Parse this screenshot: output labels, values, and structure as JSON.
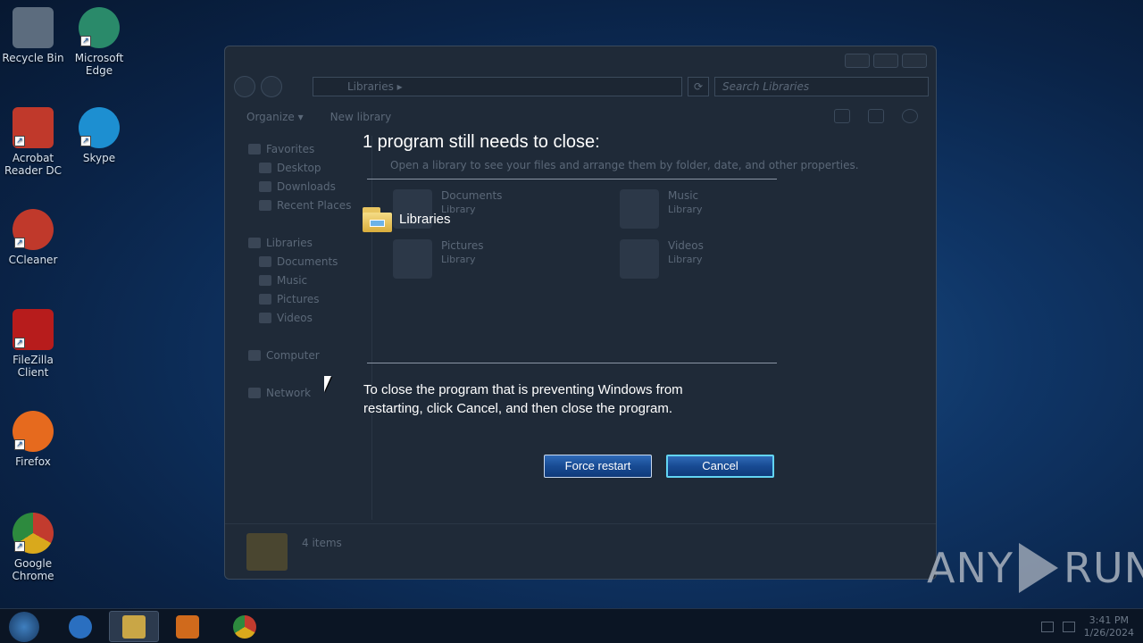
{
  "desktop": {
    "icons": [
      {
        "label": "Recycle Bin",
        "icon": "recycle-bin-icon",
        "color": "#6b7c8f"
      },
      {
        "label": "Microsoft Edge",
        "icon": "edge-icon",
        "color": "#2a8a6a"
      },
      {
        "label": "Acrobat Reader DC",
        "icon": "acrobat-icon",
        "color": "#c0392b"
      },
      {
        "label": "Skype",
        "icon": "skype-icon",
        "color": "#1d8fd1"
      },
      {
        "label": "CCleaner",
        "icon": "ccleaner-icon",
        "color": "#c0392b"
      },
      {
        "label": "FileZilla Client",
        "icon": "filezilla-icon",
        "color": "#b71c1c"
      },
      {
        "label": "Firefox",
        "icon": "firefox-icon",
        "color": "#e66a1e"
      },
      {
        "label": "Google Chrome",
        "icon": "chrome-icon",
        "color": "#d9a91c"
      }
    ]
  },
  "explorer": {
    "address": "Libraries",
    "search_placeholder": "Search Libraries",
    "toolbar": {
      "organize": "Organize ▾",
      "new_library": "New library"
    },
    "nav": {
      "favorites": "Favorites",
      "desktop": "Desktop",
      "downloads": "Downloads",
      "recent_places": "Recent Places",
      "libraries": "Libraries",
      "documents": "Documents",
      "music": "Music",
      "pictures": "Pictures",
      "videos": "Videos",
      "computer": "Computer",
      "network": "Network"
    },
    "subtitle": "Open a library to see your files and arrange them by folder, date, and other properties.",
    "libraries": [
      {
        "name": "Documents",
        "type": "Library"
      },
      {
        "name": "Music",
        "type": "Library"
      },
      {
        "name": "Pictures",
        "type": "Library"
      },
      {
        "name": "Videos",
        "type": "Library"
      }
    ],
    "status": "4 items"
  },
  "overlay": {
    "title": "1 program still needs to close:",
    "program_name": "Libraries",
    "message": "To close the program that is preventing Windows from restarting, click Cancel, and then close the program.",
    "force_restart_label": "Force restart",
    "cancel_label": "Cancel"
  },
  "taskbar": {
    "time": "3:41 PM",
    "date": "1/26/2024"
  },
  "watermark": {
    "left": "ANY",
    "right": "RUN"
  },
  "colors": {
    "button": "#184b93",
    "focus_ring": "#62d4f2"
  }
}
